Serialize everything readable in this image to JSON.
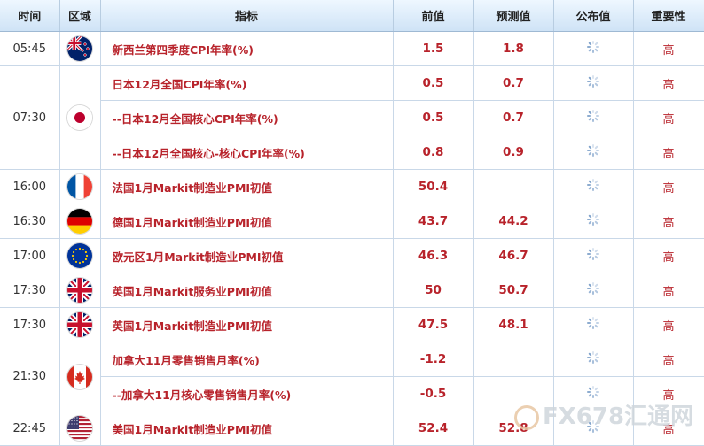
{
  "headers": {
    "time": "时间",
    "region": "区域",
    "indicator": "指标",
    "previous": "前值",
    "forecast": "预测值",
    "actual": "公布值",
    "importance": "重要性"
  },
  "rows": [
    {
      "time": "05:45",
      "flag": "nz",
      "indicator": "新西兰第四季度CPI年率(%)",
      "previous": "1.5",
      "forecast": "1.8",
      "importance": "高"
    },
    {
      "time": "07:30",
      "flag": "jp",
      "indicator": "日本12月全国CPI年率(%)",
      "previous": "0.5",
      "forecast": "0.7",
      "importance": "高"
    },
    {
      "indicator": "--日本12月全国核心CPI年率(%)",
      "previous": "0.5",
      "forecast": "0.7",
      "importance": "高"
    },
    {
      "indicator": "--日本12月全国核心-核心CPI年率(%)",
      "previous": "0.8",
      "forecast": "0.9",
      "importance": "高"
    },
    {
      "time": "16:00",
      "flag": "fr",
      "indicator": "法国1月Markit制造业PMI初值",
      "previous": "50.4",
      "forecast": "",
      "importance": "高"
    },
    {
      "time": "16:30",
      "flag": "de",
      "indicator": "德国1月Markit制造业PMI初值",
      "previous": "43.7",
      "forecast": "44.2",
      "importance": "高"
    },
    {
      "time": "17:00",
      "flag": "eu",
      "indicator": "欧元区1月Markit制造业PMI初值",
      "previous": "46.3",
      "forecast": "46.7",
      "importance": "高"
    },
    {
      "time": "17:30",
      "flag": "uk",
      "indicator": "英国1月Markit服务业PMI初值",
      "previous": "50",
      "forecast": "50.7",
      "importance": "高"
    },
    {
      "time": "17:30",
      "flag": "uk",
      "indicator": "英国1月Markit制造业PMI初值",
      "previous": "47.5",
      "forecast": "48.1",
      "importance": "高"
    },
    {
      "time": "21:30",
      "flag": "ca",
      "indicator": "加拿大11月零售销售月率(%)",
      "previous": "-1.2",
      "forecast": "",
      "importance": "高"
    },
    {
      "indicator": "--加拿大11月核心零售销售月率(%)",
      "previous": "-0.5",
      "forecast": "",
      "importance": "高"
    },
    {
      "time": "22:45",
      "flag": "us",
      "indicator": "美国1月Markit制造业PMI初值",
      "previous": "52.4",
      "forecast": "52.8",
      "importance": "高"
    }
  ],
  "watermark": "FX678汇通网",
  "colors": {
    "value_red": "#b8232b",
    "header_bg": "#d6e7f7",
    "border": "#c9d8e8",
    "spinner": "#6f96c4"
  }
}
